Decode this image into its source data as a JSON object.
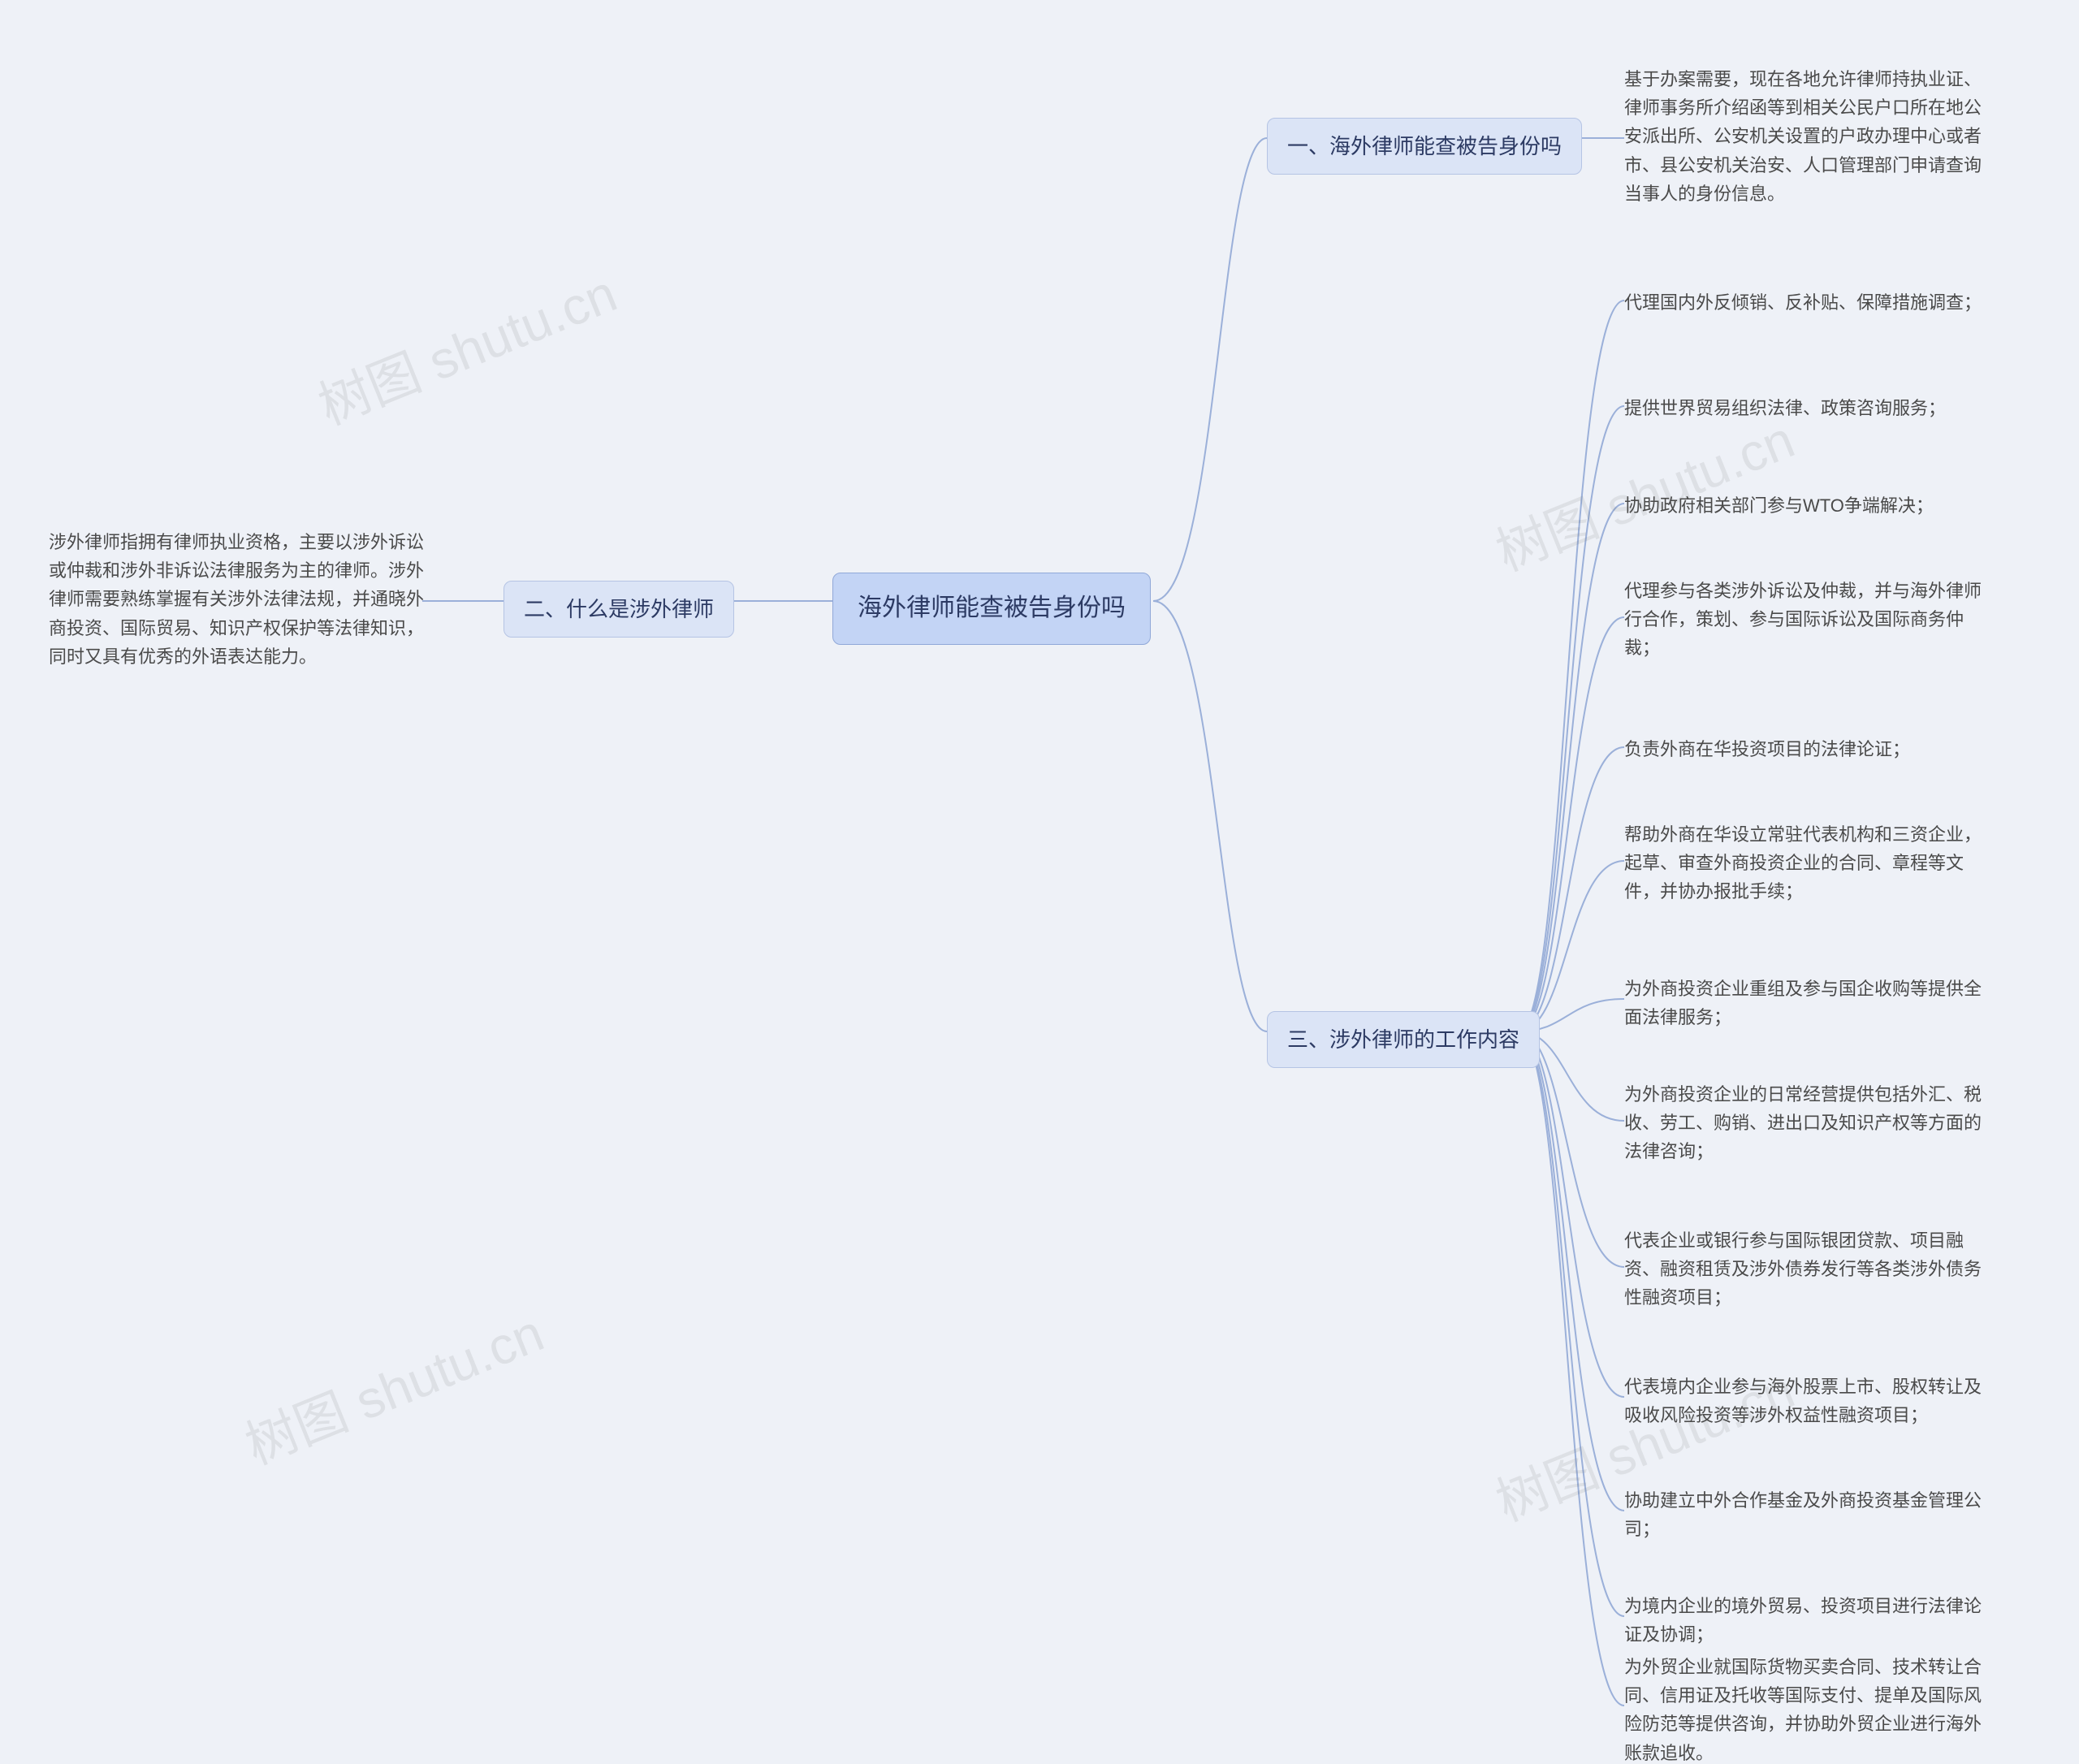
{
  "root": {
    "title": "海外律师能查被告身份吗"
  },
  "branch_left": {
    "title": "二、什么是涉外律师",
    "leaf": "涉外律师指拥有律师执业资格，主要以涉外诉讼或仲裁和涉外非诉讼法律服务为主的律师。涉外律师需要熟练掌握有关涉外法律法规，并通晓外商投资、国际贸易、知识产权保护等法律知识，同时又具有优秀的外语表达能力。"
  },
  "branch_right_1": {
    "title": "一、海外律师能查被告身份吗",
    "leaf": "基于办案需要，现在各地允许律师持执业证、律师事务所介绍函等到相关公民户口所在地公安派出所、公安机关设置的户政办理中心或者市、县公安机关治安、人口管理部门申请查询当事人的身份信息。"
  },
  "branch_right_2": {
    "title": "三、涉外律师的工作内容",
    "leaves": [
      "代理国内外反倾销、反补贴、保障措施调查；",
      "提供世界贸易组织法律、政策咨询服务；",
      "协助政府相关部门参与WTO争端解决；",
      "代理参与各类涉外诉讼及仲裁，并与海外律师行合作，策划、参与国际诉讼及国际商务仲裁；",
      "负责外商在华投资项目的法律论证；",
      "帮助外商在华设立常驻代表机构和三资企业，起草、审查外商投资企业的合同、章程等文件，并协办报批手续；",
      "为外商投资企业重组及参与国企收购等提供全面法律服务；",
      "为外商投资企业的日常经营提供包括外汇、税收、劳工、购销、进出口及知识产权等方面的法律咨询；",
      "代表企业或银行参与国际银团贷款、项目融资、融资租赁及涉外债券发行等各类涉外债务性融资项目；",
      "代表境内企业参与海外股票上市、股权转让及吸收风险投资等涉外权益性融资项目；",
      "协助建立中外合作基金及外商投资基金管理公司；",
      "为境内企业的境外贸易、投资项目进行法律论证及协调；",
      "为外贸企业就国际货物买卖合同、技术转让合同、信用证及托收等国际支付、提单及国际风险防范等提供咨询，并协助外贸企业进行海外账款追收。"
    ]
  },
  "watermark": "树图 shutu.cn"
}
